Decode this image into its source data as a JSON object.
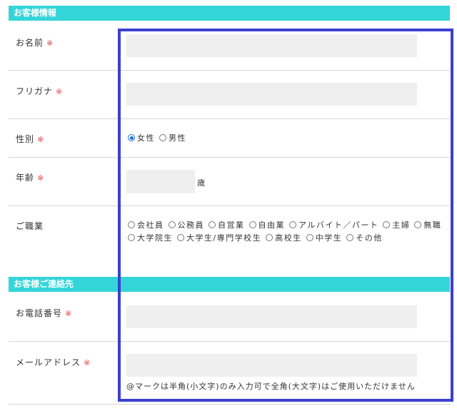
{
  "customer_info": {
    "header": "お客様情報",
    "name": {
      "label": "お名前",
      "required": "※",
      "value": ""
    },
    "furigana": {
      "label": "フリガナ",
      "required": "※",
      "value": ""
    },
    "gender": {
      "label": "性別",
      "required": "※",
      "options": [
        {
          "label": "女性",
          "checked": true
        },
        {
          "label": "男性",
          "checked": false
        }
      ]
    },
    "age": {
      "label": "年齢",
      "required": "※",
      "value": "",
      "unit": "歳"
    },
    "occupation": {
      "label": "ご職業",
      "options_line1": [
        "会社員",
        "公務員",
        "自営業",
        "自由業",
        "アルバイト／パート",
        "主婦",
        "無職"
      ],
      "options_line2": [
        "大学院生",
        "大学生/専門学校生",
        "高校生",
        "中学生",
        "その他"
      ]
    }
  },
  "contact_info": {
    "header": "お客様ご連絡先",
    "phone": {
      "label": "お電話番号",
      "required": "※",
      "value": ""
    },
    "email": {
      "label": "メールアドレス",
      "required": "※",
      "value": "",
      "note": "@マークは半角(小文字)のみ入力可で全角(大文字)はご使用いただけません"
    }
  },
  "colors": {
    "section_header": "#33d5d9",
    "required_mark": "#e03b3b",
    "input_bg": "#efefef",
    "highlight_border": "#3a3fd0",
    "radio_checked": "#1a6fd6"
  }
}
